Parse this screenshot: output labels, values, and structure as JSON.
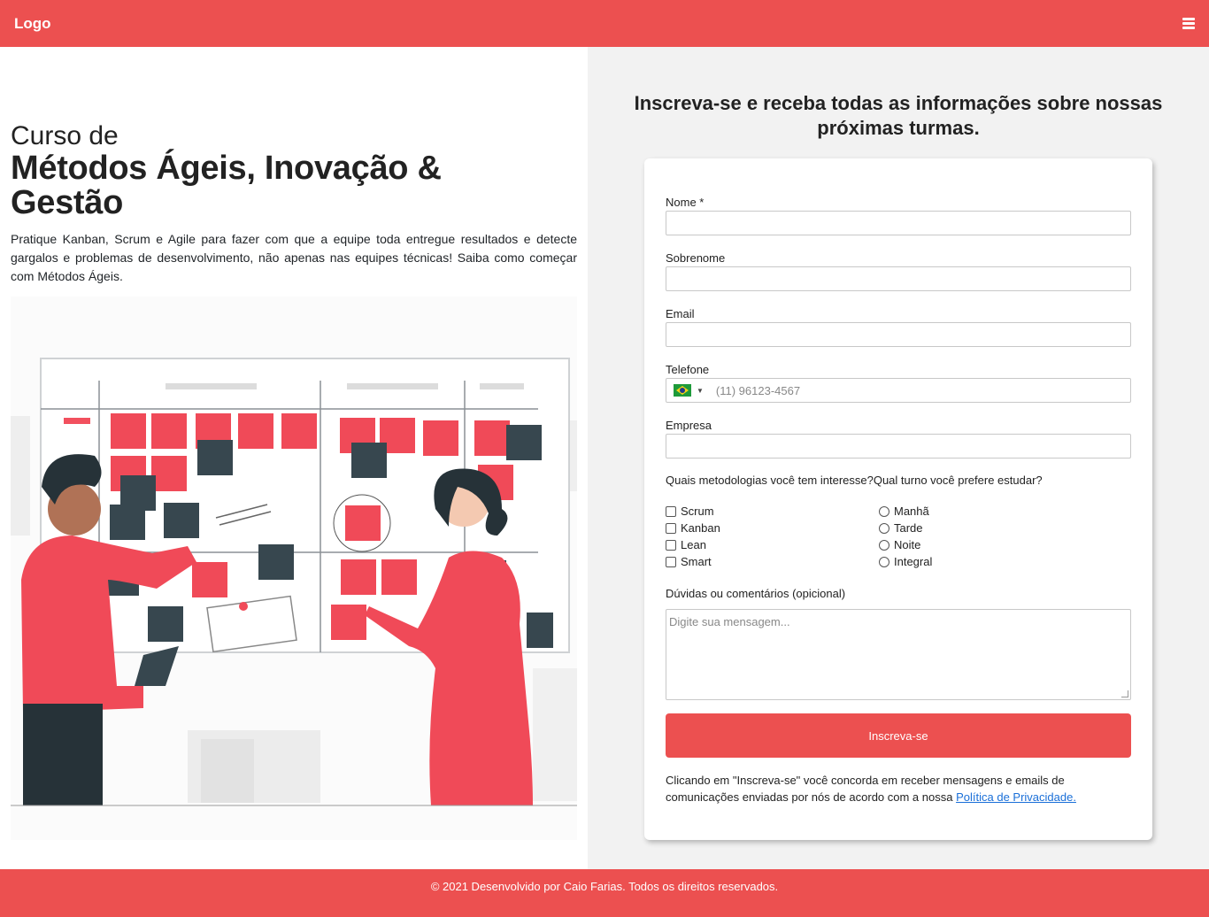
{
  "header": {
    "logo": "Logo",
    "menu_icon": "hamburger-menu-icon"
  },
  "hero": {
    "prefix": "Curso de",
    "title": "Métodos Ágeis, Inovação & Gestão",
    "description": "Pratique Kanban, Scrum e Agile para fazer com que a equipe toda entregue resultados e detecte gargalos e problemas de desenvolvimento, não apenas nas equipes técnicas! Saiba como começar com Métodos Ágeis.",
    "illustration_icon": "kanban-board-team-illustration"
  },
  "form": {
    "heading": "Inscreva-se e receba todas as informações sobre nossas próximas turmas.",
    "fields": {
      "nome": {
        "label": "Nome *",
        "value": ""
      },
      "sobrenome": {
        "label": "Sobrenome",
        "value": ""
      },
      "email": {
        "label": "Email",
        "value": ""
      },
      "telefone": {
        "label": "Telefone",
        "placeholder": "(11) 96123-4567",
        "country_flag": "brazil-flag-icon"
      },
      "empresa": {
        "label": "Empresa",
        "value": ""
      }
    },
    "questions_label": "Quais metodologias você tem interesse?Qual turno você prefere estudar?",
    "methodologies": [
      "Scrum",
      "Kanban",
      "Lean",
      "Smart"
    ],
    "shifts": [
      "Manhã",
      "Tarde",
      "Noite",
      "Integral"
    ],
    "comments": {
      "label": "Dúvidas ou comentários (opicional)",
      "placeholder": "Digite sua mensagem..."
    },
    "submit_label": "Inscreva-se",
    "consent_text": "Clicando em \"Inscreva-se\" você concorda em receber mensagens e emails de comunicações enviadas por nós de acordo com a nossa",
    "privacy_link": "Política de Privacidade."
  },
  "footer": {
    "text": "© 2021 Desenvolvido por Caio Farias. Todos os direitos reservados."
  },
  "colors": {
    "brand": "#ec5050",
    "panel": "#f2f2f2",
    "link": "#1a6fd8",
    "sticky_dark": "#37474f"
  }
}
